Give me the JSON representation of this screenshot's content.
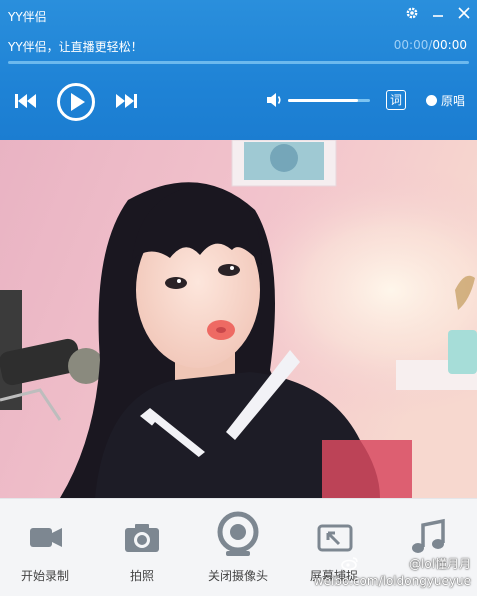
{
  "window": {
    "title": "YY伴侣"
  },
  "player": {
    "song_title": "YY伴侣，让直播更轻松！",
    "time_current": "00:00",
    "time_separator": "/",
    "time_total": "00:00",
    "progress_fraction": 0.0,
    "volume_fraction": 0.85,
    "lyrics_label": "词",
    "original_label": "原唱"
  },
  "toolbar": {
    "items": [
      {
        "label": "开始录制",
        "icon": "video-camera-icon"
      },
      {
        "label": "拍照",
        "icon": "photo-camera-icon"
      },
      {
        "label": "关闭摄像头",
        "icon": "webcam-icon"
      },
      {
        "label": "屏幕捕捉",
        "icon": "screen-capture-icon"
      },
      {
        "label": "",
        "icon": "music-note-icon"
      }
    ]
  },
  "watermark": {
    "text": "weibo.com/loldongyueyue",
    "handle": "@lol懂月月"
  },
  "colors": {
    "accent": "#1f83d6",
    "toolbar_bg": "#f4f5f7",
    "icon_gray": "#7d8791"
  }
}
